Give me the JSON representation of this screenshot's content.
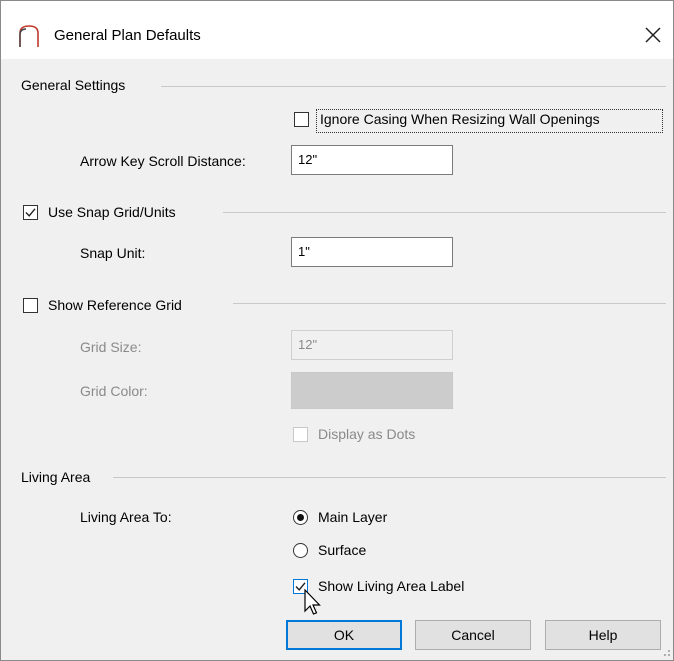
{
  "window": {
    "title": "General Plan Defaults",
    "app_icon": "arch-icon",
    "close_icon": "close-icon"
  },
  "general_settings": {
    "group_label": "General Settings",
    "ignore_casing_label": "Ignore Casing When Resizing Wall Openings",
    "ignore_casing_checked": false,
    "arrow_key_label": "Arrow Key Scroll Distance:",
    "arrow_key_value": "12\""
  },
  "snap_grid": {
    "group_label": "Use Snap Grid/Units",
    "checked": true,
    "snap_unit_label": "Snap Unit:",
    "snap_unit_value": "1\""
  },
  "reference_grid": {
    "group_label": "Show Reference Grid",
    "checked": false,
    "grid_size_label": "Grid Size:",
    "grid_size_value": "12\"",
    "grid_color_label": "Grid Color:",
    "grid_color": "#cccccc",
    "display_dots_label": "Display as Dots",
    "display_dots_checked": false
  },
  "living_area": {
    "group_label": "Living Area",
    "living_area_to_label": "Living Area To:",
    "options": [
      "Main Layer",
      "Surface"
    ],
    "selected": "Main Layer",
    "show_label_text": "Show Living Area Label",
    "show_label_checked": true
  },
  "buttons": {
    "ok": "OK",
    "cancel": "Cancel",
    "help": "Help"
  },
  "colors": {
    "accent": "#0078d7",
    "background": "#f0f0f0"
  }
}
